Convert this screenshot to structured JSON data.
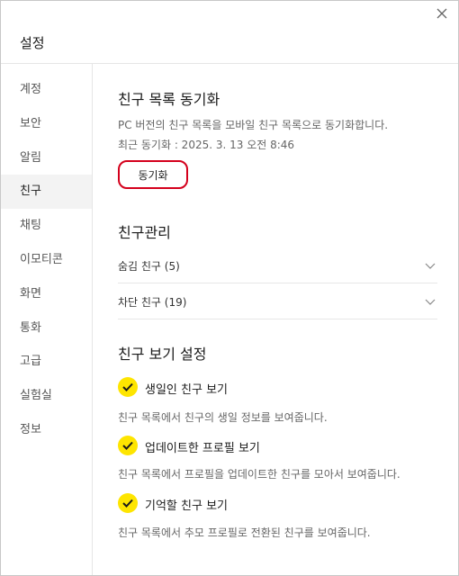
{
  "window": {
    "title": "설정"
  },
  "sidebar": {
    "items": [
      {
        "label": "계정",
        "active": false
      },
      {
        "label": "보안",
        "active": false
      },
      {
        "label": "알림",
        "active": false
      },
      {
        "label": "친구",
        "active": true
      },
      {
        "label": "채팅",
        "active": false
      },
      {
        "label": "이모티콘",
        "active": false
      },
      {
        "label": "화면",
        "active": false
      },
      {
        "label": "통화",
        "active": false
      },
      {
        "label": "고급",
        "active": false
      },
      {
        "label": "실험실",
        "active": false
      },
      {
        "label": "정보",
        "active": false
      }
    ]
  },
  "sync": {
    "title": "친구 목록 동기화",
    "description": "PC 버전의 친구 목록을 모바일 친구 목록으로 동기화합니다.",
    "last_sync": "최근 동기화 : 2025. 3. 13 오전 8:46",
    "button_label": "동기화",
    "button_highlight_color": "#d4001c"
  },
  "manage": {
    "title": "친구관리",
    "hidden_label": "숨김 친구 (5)",
    "blocked_label": "차단 친구 (19)"
  },
  "view": {
    "title": "친구 보기 설정",
    "check_color": "#fee500",
    "options": [
      {
        "label": "생일인 친구 보기",
        "description": "친구 목록에서 친구의 생일 정보를 보여줍니다.",
        "checked": true
      },
      {
        "label": "업데이트한 프로필 보기",
        "description": "친구 목록에서 프로필을 업데이트한 친구를 모아서 보여줍니다.",
        "checked": true
      },
      {
        "label": "기억할 친구 보기",
        "description": "친구 목록에서 추모 프로필로 전환된 친구를 보여줍니다.",
        "checked": true
      }
    ]
  }
}
